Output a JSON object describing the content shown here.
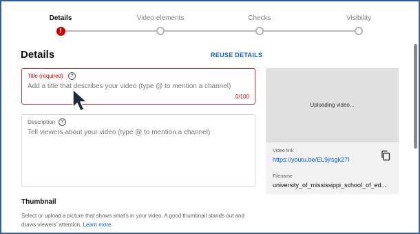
{
  "stepper": {
    "steps": [
      {
        "label": "Details",
        "state": "error"
      },
      {
        "label": "Video elements",
        "state": "pending"
      },
      {
        "label": "Checks",
        "state": "pending"
      },
      {
        "label": "Visibility",
        "state": "pending"
      }
    ],
    "error_glyph": "!"
  },
  "header": {
    "title": "Details",
    "reuse_label": "REUSE DETAILS"
  },
  "title_field": {
    "label": "Title (required)",
    "placeholder": "Add a title that describes your video (type @ to mention a channel)",
    "value": "",
    "char_count": "0/100"
  },
  "description_field": {
    "label": "Description",
    "placeholder": "Tell viewers about your video (type @ to mention a channel)",
    "value": ""
  },
  "help_glyph": "?",
  "thumbnail": {
    "title": "Thumbnail",
    "description": "Select or upload a picture that shows what's in your video. A good thumbnail stands out and draws viewers' attention. ",
    "learn_more": "Learn more"
  },
  "preview": {
    "status": "Uploading video...",
    "video_link_label": "Video link",
    "video_link": "https://youtu.be/EL9jrsgk27I",
    "filename_label": "Filename",
    "filename": "university_of_mississippi_school_of_ed..."
  },
  "colors": {
    "accent": "#065fd4",
    "error": "#cc0000",
    "frame": "#2f5f9a"
  }
}
